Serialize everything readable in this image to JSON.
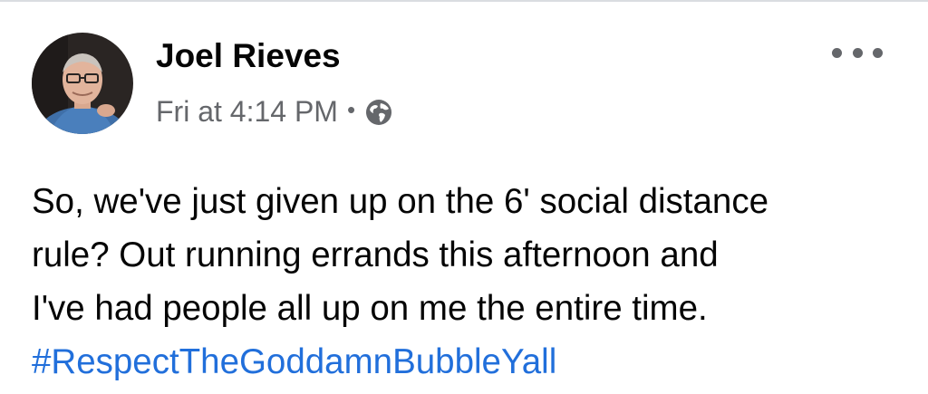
{
  "post": {
    "author": {
      "name": "Joel Rieves",
      "avatar_icon": "profile-photo"
    },
    "meta": {
      "timestamp": "Fri at 4:14 PM",
      "separator": "•",
      "privacy_icon": "globe-icon"
    },
    "more_icon": "more-options-icon",
    "body_lines": [
      "So, we've just given up on the 6' social distance",
      "rule? Out running errands this afternoon and",
      "I've had people all up on me the entire time."
    ],
    "hashtag": "#RespectTheGoddamnBubbleYall"
  },
  "colors": {
    "text_primary": "#050505",
    "text_secondary": "#65676b",
    "link": "#216fdb",
    "divider": "#dadde1"
  }
}
